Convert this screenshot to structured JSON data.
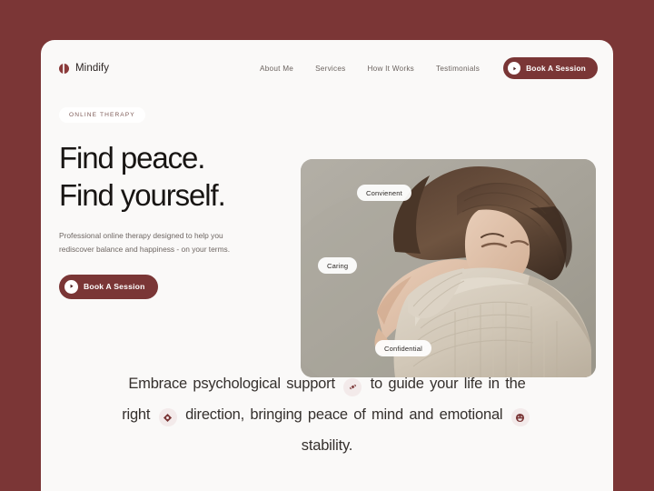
{
  "theme": {
    "backdrop": "#7B3636",
    "card_bg": "#FAF9F8",
    "accent": "#7A3636",
    "heading": "#181513",
    "muted_text": "#6E6662",
    "badge_bg": "#F3EAEA",
    "photo_bg": "#A8A49B"
  },
  "header": {
    "brand": "Mindify",
    "nav": [
      {
        "label": "About Me"
      },
      {
        "label": "Services"
      },
      {
        "label": "How It Works"
      },
      {
        "label": "Testimonials"
      }
    ],
    "cta": {
      "label": "Book A Session",
      "icon": "play-circle-icon"
    }
  },
  "hero": {
    "eyebrow": "ONLINE THERAPY",
    "headline_line1": "Find peace.",
    "headline_line2": "Find yourself.",
    "subtitle": "Professional online therapy designed to help you rediscover balance and happiness - on your terms.",
    "cta": {
      "label": "Book A Session",
      "icon": "play-circle-icon"
    },
    "image": {
      "alt": "Woman with long brown hair in a cream knit sweater hugging her knees",
      "pills": [
        {
          "label": "Convienent",
          "name": "pill-convenient"
        },
        {
          "label": "Caring",
          "name": "pill-caring"
        },
        {
          "label": "Confidential",
          "name": "pill-confidential"
        }
      ]
    }
  },
  "statement": {
    "part1": "Embrace psychological support",
    "icon1": "hands-heart-icon",
    "part2": "to guide your life in the right",
    "icon2": "compass-diamond-icon",
    "part3": "direction, bringing peace of mind and emotional",
    "icon3": "smiley-face-icon",
    "part4": "stability."
  }
}
